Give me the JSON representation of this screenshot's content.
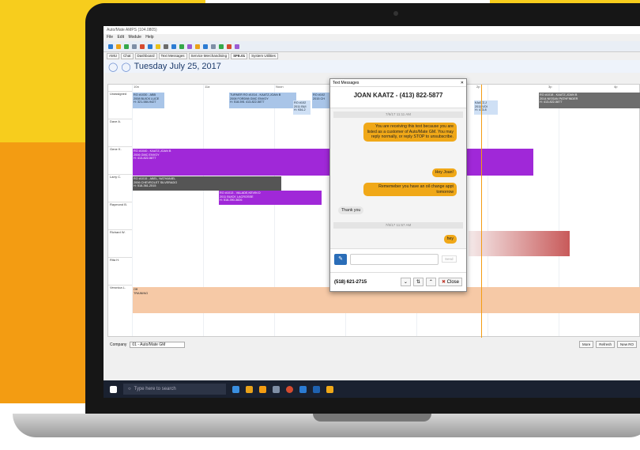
{
  "window": {
    "title": "Auto/Mate AMPS (104.0805)"
  },
  "menu": [
    "File",
    "Edit",
    "Module",
    "Help"
  ],
  "tabs": [
    {
      "label": "AMU"
    },
    {
      "label": "Chat"
    },
    {
      "label": "Dashboard"
    },
    {
      "label": "Text Messages"
    },
    {
      "label": "Service Merchandising"
    },
    {
      "label": "SFE.01"
    },
    {
      "label": "System Utilities"
    }
  ],
  "schedule": {
    "date": "Tuesday July 25, 2017",
    "time_labels": [
      "10a",
      "11a",
      "Noon",
      "1p",
      "2p",
      "3p",
      "4p",
      "5p"
    ],
    "rows": [
      "Unassigned",
      "Dave A.",
      "Gene K.",
      "Larry C.",
      "Raymond B.",
      "Richard W.",
      "Rita H.",
      "Veronica L."
    ],
    "appointments": [
      {
        "text": "RO #1030 - ABB\n2008 BUICK LUCE\nH: 321-584-9427"
      },
      {
        "text": "TURNER RO #1014 - KAATZ,JOAN B\n2008 FORD98 GMC ENVOY\nH: 518-591 413-822-5877"
      },
      {
        "text": "RO #102\n2015 CH"
      },
      {
        "text": "RO #102\n2011 BUI\nH: 934-2"
      },
      {
        "text": "RO #1040 - KAATZ,JOAN B\n2006 GMC ENVOY\nH: 413-822-5877"
      },
      {
        "text": "RO #1015 - ABEL, NATHANIEL\n2006 CHEVROLET SILVERADO\nH: 518-361-2515"
      },
      {
        "text": "RO #1013 - VALADE,KEVIN D\n2011 BUICK LACROSSE\nH: 518-390-3826"
      },
      {
        "text": "RO #1018 - KAATZ,JOAN B\n2014 NISSAN PATHFINDER\nH: 413-822-5877"
      },
      {
        "text": "KAATZ,J\n2011 VOI\nH: 413-8"
      },
      {
        "text": "Off\nTRAINING"
      }
    ]
  },
  "bottom": {
    "company_label": "Company",
    "company_value": "01 - Auto/Mate GM",
    "more": "More",
    "refresh": "Refresh",
    "new_ro": "New RO"
  },
  "taskbar": {
    "search_placeholder": "Type here to search"
  },
  "modal": {
    "window_title": "Text Messages",
    "contact": "JOAN KAATZ - (413) 822-5877",
    "messages": [
      {
        "type": "timestamp",
        "text": "7/6/17 11:11 AM"
      },
      {
        "type": "out",
        "text": "You are receiving this text because you are listed as a customer of Auto/Mate GM. You may reply normally, or reply STOP to unsubscribe."
      },
      {
        "type": "out",
        "text": "Hey Joan!"
      },
      {
        "type": "out",
        "text": "Rememeber you have an oil change appt tomorrow"
      },
      {
        "type": "in",
        "text": "Thank you"
      },
      {
        "type": "timestamp",
        "text": "7/6/17 11:57 AM"
      },
      {
        "type": "out",
        "text": "hey"
      }
    ],
    "send_label": "Send",
    "phone": "(518) 621-2715",
    "close_label": "Close"
  },
  "colors": {
    "accent_orange": "#f0a818",
    "purple_appt": "#a028d8",
    "gray_appt": "#555555",
    "blue_appt": "#a9c5e8",
    "red_appt": "#c85a5a"
  }
}
